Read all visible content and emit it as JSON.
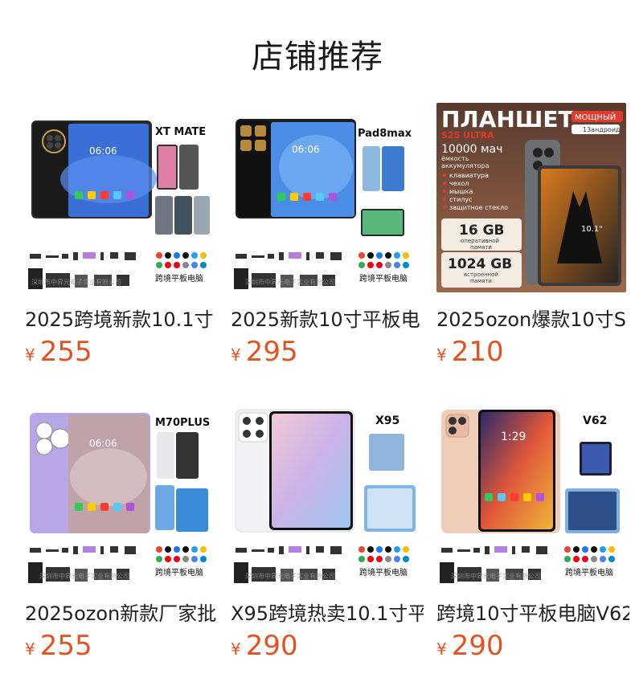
{
  "section_title": "店铺推荐",
  "currency_symbol": "¥",
  "products": [
    {
      "name": "2025跨境新款10.1寸",
      "price": "255",
      "thumb": {
        "tag": "XT MATE",
        "watermark": "深圳市中昇元电子实业有限公司",
        "badge": "跨境平板电脑",
        "screen_time": "06:06",
        "body_color": "#2b2b2b",
        "screen_color": "#3a6fd8"
      }
    },
    {
      "name": "2025新款10寸平板电",
      "price": "295",
      "thumb": {
        "tag": "Pad8max",
        "watermark": "深圳市中昇元电子实业有限公司",
        "badge": "跨境平板电脑",
        "screen_time": "06:06",
        "body_color": "#1f1f1f",
        "screen_color": "#4a8de6"
      }
    },
    {
      "name": "2025ozon爆款10寸S",
      "price": "210",
      "thumb": {
        "heading": "ПЛАНШЕТ",
        "model": "S25 ULTRA",
        "mode_label": "МОЩНЫЙ",
        "android_label": "13андроид",
        "battery": "10000 мач",
        "battery_sub1": "ёмкость",
        "battery_sub2": "аккумулятора",
        "features": [
          "клавиатура",
          "чехол",
          "мышка",
          "стилус",
          "защитное стекло"
        ],
        "ram": "16 GB",
        "ram_sub1": "оперативной",
        "ram_sub2": "памяти",
        "rom": "1024 GB",
        "rom_sub1": "встроенной",
        "rom_sub2": "памяти",
        "size": "10.1\""
      }
    },
    {
      "name": "2025ozon新款厂家批",
      "price": "255",
      "thumb": {
        "tag": "M70PLUS",
        "watermark": "深圳市中昇元电子实业有限公司",
        "badge": "跨境平板电脑",
        "screen_time": "06:06",
        "body_color": "#b9a6e6",
        "screen_color": "#bfa3a6"
      }
    },
    {
      "name": "X95跨境热卖10.1寸平",
      "price": "290",
      "thumb": {
        "tag": "X95",
        "watermark": "深圳市中昇元电子实业有限公司",
        "badge": "跨境平板电脑",
        "screen_time": "",
        "body_color": "#f2f2f4",
        "screen_color": "#c9b3e8"
      }
    },
    {
      "name": "跨境10寸平板电脑V62",
      "price": "290",
      "thumb": {
        "tag": "V62",
        "watermark": "深圳市中昇元电子实业有限公司",
        "badge": "跨境平板电脑",
        "screen_time": "1:29",
        "body_color": "#f0cdb8",
        "screen_color": "#e0573a"
      }
    }
  ]
}
